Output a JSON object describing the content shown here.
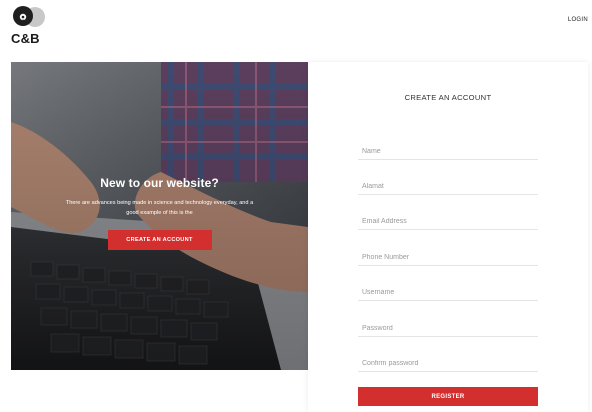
{
  "header": {
    "logo_text": "C&B",
    "login_label": "LOGIN"
  },
  "hero": {
    "title": "New to our website?",
    "text": "There are advances being made in science and technology everyday, and a good example of this is the",
    "button_label": "CREATE AN ACCOUNT"
  },
  "form": {
    "title": "CREATE AN ACCOUNT",
    "fields": {
      "name": "Name",
      "alamat": "Alamat",
      "email": "Email Address",
      "phone": "Phone Number",
      "username": "Username",
      "password": "Password",
      "confirm_password": "Confirm password"
    },
    "register_label": "REGISTER"
  },
  "colors": {
    "accent": "#d32f2f",
    "text": "#333333",
    "placeholder": "#9a9a9a"
  }
}
